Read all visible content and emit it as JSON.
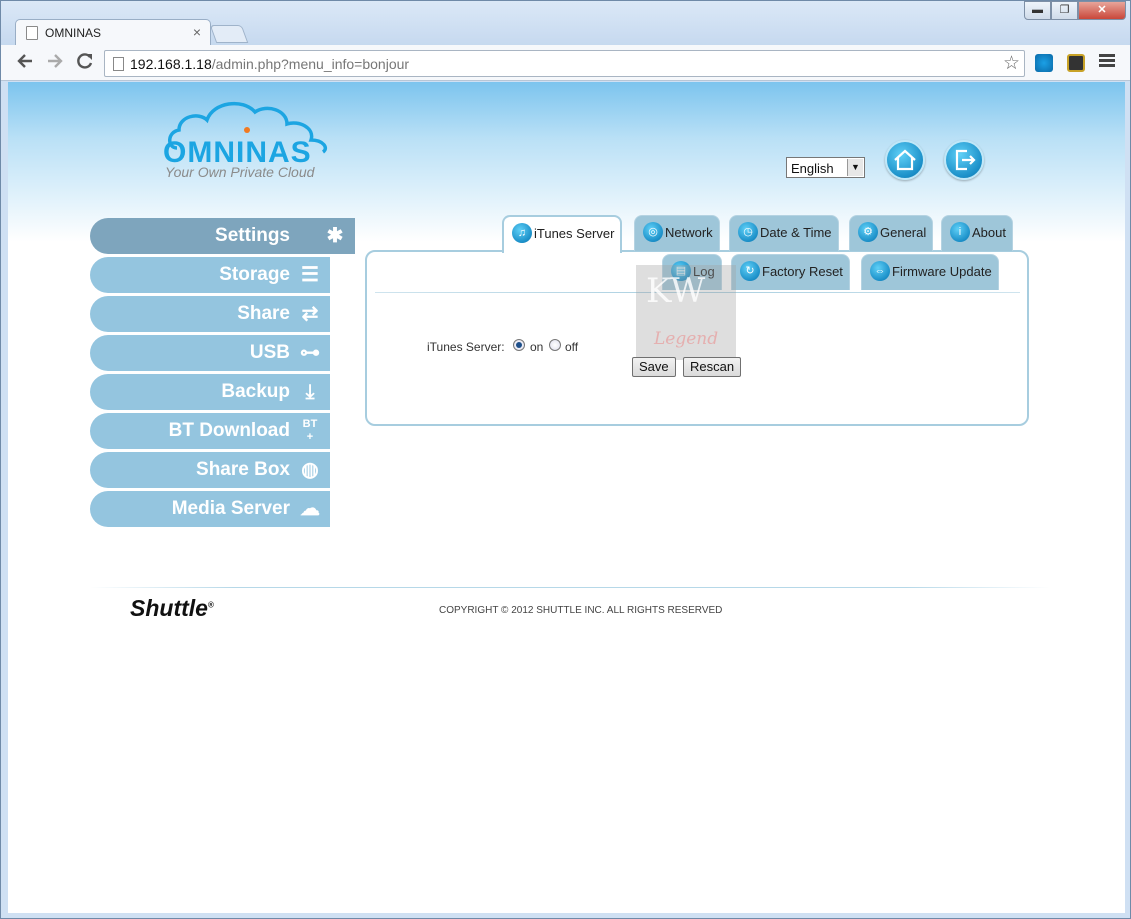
{
  "browser": {
    "tab_title": "OMNINAS",
    "tab_close": "×",
    "url_host": "192.168.1.18",
    "url_path": "/admin.php?menu_info=bonjour",
    "win_min": "▬",
    "win_max": "❐",
    "win_close": "✕"
  },
  "header": {
    "logo_text": "OMNINAS",
    "logo_tagline": "Your Own Private Cloud",
    "language": "English"
  },
  "sidebar": {
    "items": [
      {
        "label": "Settings",
        "icon": "settings-icon"
      },
      {
        "label": "Storage",
        "icon": "storage-icon"
      },
      {
        "label": "Share",
        "icon": "share-icon"
      },
      {
        "label": "USB",
        "icon": "usb-icon"
      },
      {
        "label": "Backup",
        "icon": "backup-icon"
      },
      {
        "label": "BT Download",
        "icon": "bt-download-icon"
      },
      {
        "label": "Share Box",
        "icon": "share-box-icon"
      },
      {
        "label": "Media Server",
        "icon": "media-server-icon"
      }
    ]
  },
  "tabs": {
    "row1": [
      "iTunes Server",
      "Network",
      "Date & Time",
      "General",
      "About"
    ],
    "row2": [
      "Log",
      "Factory Reset",
      "Firmware Update"
    ]
  },
  "form": {
    "label": "iTunes Server:",
    "on_label": "on",
    "off_label": "off",
    "selected": "on",
    "save_label": "Save",
    "rescan_label": "Rescan"
  },
  "watermark": {
    "line1": "KW",
    "line2": "Legend"
  },
  "footer": {
    "brand": "Shuttle",
    "brand_mark": "®",
    "copyright": "COPYRIGHT © 2012 SHUTTLE INC. ALL RIGHTS RESERVED"
  }
}
